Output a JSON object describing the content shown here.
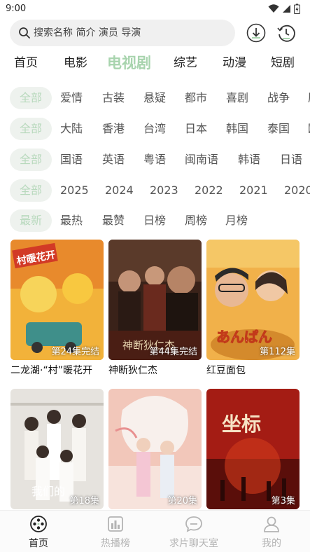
{
  "status": {
    "time": "9:00"
  },
  "search": {
    "placeholder": "搜索名称 简介 演员 导演"
  },
  "nav_tabs": [
    "首页",
    "电影",
    "电视剧",
    "综艺",
    "动漫",
    "短剧"
  ],
  "nav_active": "电视剧",
  "filters": {
    "genre": [
      "全部",
      "爱情",
      "古装",
      "悬疑",
      "都市",
      "喜剧",
      "战争",
      "历"
    ],
    "region": [
      "全部",
      "大陆",
      "香港",
      "台湾",
      "日本",
      "韩国",
      "泰国",
      "欧"
    ],
    "language": [
      "全部",
      "国语",
      "英语",
      "粤语",
      "闽南语",
      "韩语",
      "日语"
    ],
    "year": [
      "全部",
      "2025",
      "2024",
      "2023",
      "2022",
      "2021",
      "2020"
    ],
    "sort": [
      "最新",
      "最热",
      "最赞",
      "日榜",
      "周榜",
      "月榜"
    ]
  },
  "cards": [
    {
      "title": "二龙湖·“村”暖花开",
      "badge": "第24集完结",
      "poster_text": "村暖花开"
    },
    {
      "title": "神断狄仁杰",
      "badge": "第44集完结",
      "poster_text": "神断狄仁杰"
    },
    {
      "title": "红豆面包",
      "badge": "第112集",
      "poster_text": "あんぱん"
    },
    {
      "title": "",
      "badge": "第18集",
      "poster_text": "我们的"
    },
    {
      "title": "",
      "badge": "第20集",
      "poster_text": ""
    },
    {
      "title": "",
      "badge": "第3集",
      "poster_text": "坐标"
    }
  ],
  "bottom_nav": [
    "首页",
    "热播榜",
    "求片聊天室",
    "我的"
  ],
  "colors": {
    "accent": "#a8d4ae",
    "chip_bg": "#eef2ee",
    "inactive": "#b4b4b4"
  }
}
